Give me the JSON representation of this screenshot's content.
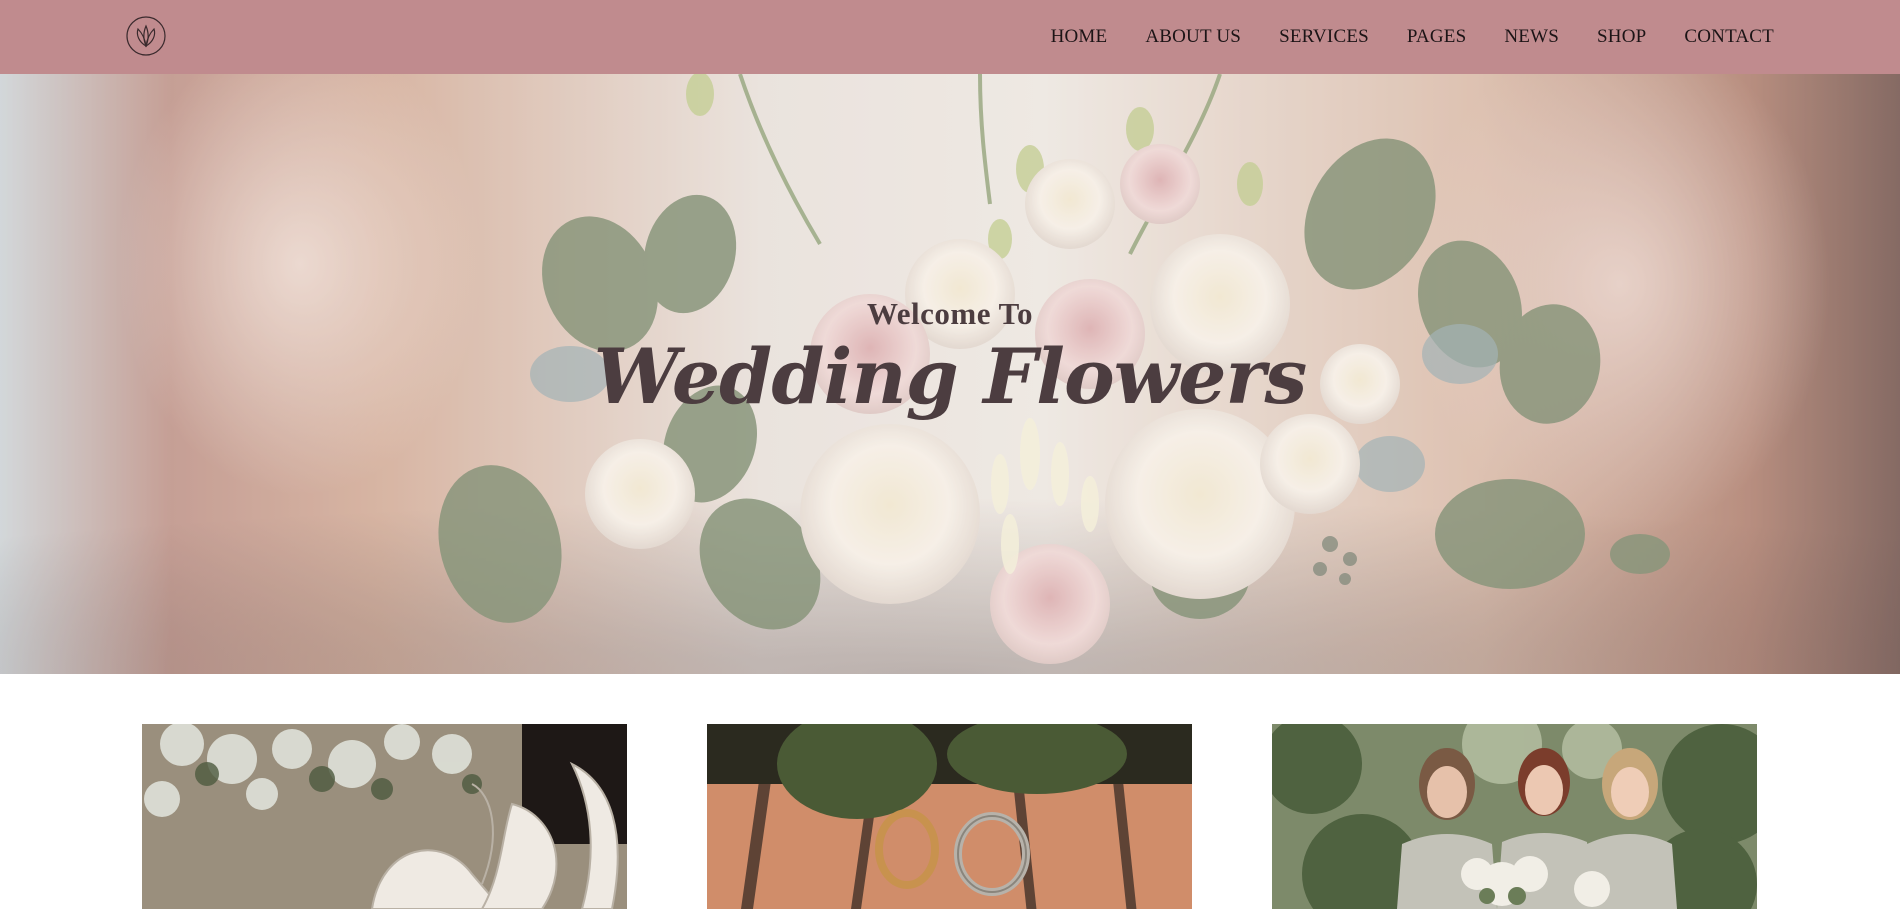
{
  "header": {
    "logo_icon": "lotus-leaf-icon",
    "nav": [
      {
        "label": "HOME"
      },
      {
        "label": "ABOUT US"
      },
      {
        "label": "SERVICES"
      },
      {
        "label": "PAGES"
      },
      {
        "label": "NEWS"
      },
      {
        "label": "SHOP"
      },
      {
        "label": "CONTACT"
      }
    ]
  },
  "hero": {
    "welcome": "Welcome To",
    "title": "Wedding Flowers"
  },
  "cards": [
    {
      "image": "bridal-shoes-photo"
    },
    {
      "image": "wedding-rings-photo"
    },
    {
      "image": "bridesmaids-photo"
    }
  ],
  "colors": {
    "header_bg": "#c08b8e",
    "nav_text": "#1c1416",
    "hero_text": "#4c3d40"
  }
}
